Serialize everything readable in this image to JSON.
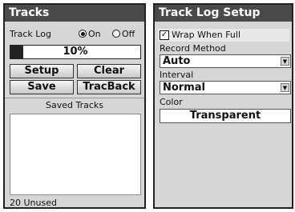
{
  "tracks": {
    "title": "Tracks",
    "track_log_label": "Track Log",
    "on_label": "On",
    "off_label": "Off",
    "progress_label": "10%",
    "progress_percent": 10,
    "buttons": {
      "setup": "Setup",
      "clear": "Clear",
      "save": "Save",
      "tracback": "TracBack"
    },
    "saved_tracks_label": "Saved Tracks",
    "unused_label": "20 Unused"
  },
  "setup": {
    "title": "Track Log Setup",
    "wrap_label": "Wrap When Full",
    "check_mark": "✓",
    "record_method_label": "Record Method",
    "record_method_value": "Auto",
    "interval_label": "Interval",
    "interval_value": "Normal",
    "color_label": "Color",
    "color_value": "Transparent"
  }
}
